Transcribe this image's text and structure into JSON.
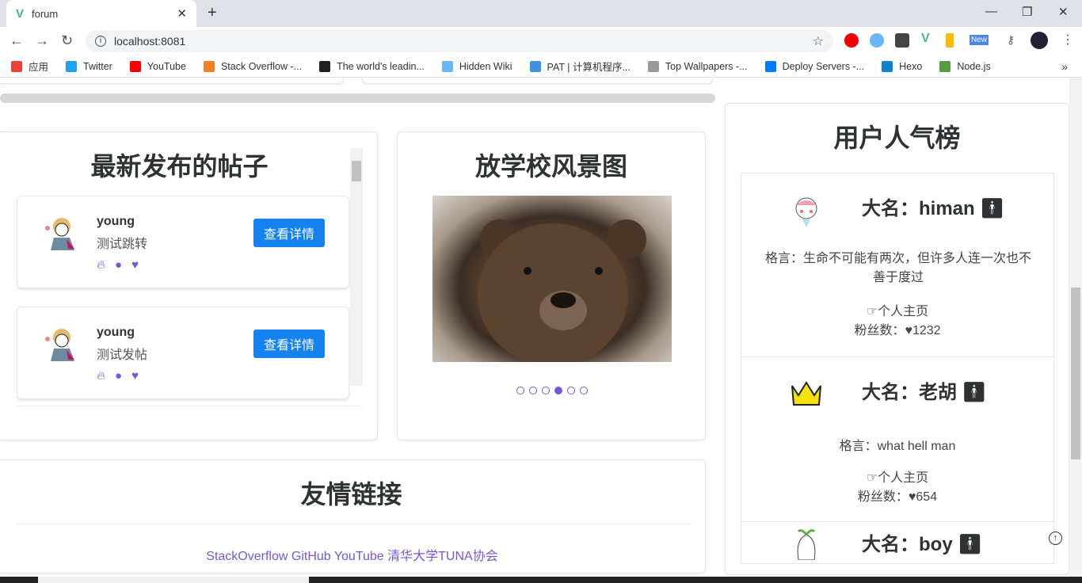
{
  "browser": {
    "tab_title": "forum",
    "url": "localhost:8081",
    "bookmarks": [
      {
        "label": "应用",
        "color": "#e94235"
      },
      {
        "label": "Twitter",
        "color": "#1da1f2"
      },
      {
        "label": "YouTube",
        "color": "#ff0000"
      },
      {
        "label": "Stack Overflow -...",
        "color": "#f48024"
      },
      {
        "label": "The world's leadin...",
        "color": "#222222"
      },
      {
        "label": "Hidden Wiki",
        "color": "#6ab7f5"
      },
      {
        "label": "PAT | 计算机程序...",
        "color": "#3d8fe0"
      },
      {
        "label": "Top Wallpapers -...",
        "color": "#999999"
      },
      {
        "label": "Deploy Servers -...",
        "color": "#007bfc"
      },
      {
        "label": "Hexo",
        "color": "#0e83cd"
      },
      {
        "label": "Node.js",
        "color": "#539e43"
      }
    ],
    "ext_badge": "New"
  },
  "latest": {
    "title": "最新发布的帖子",
    "posts": [
      {
        "user": "young",
        "title": "测试跳转",
        "button": "查看详情"
      },
      {
        "user": "young",
        "title": "测试发帖",
        "button": "查看详情"
      }
    ]
  },
  "scenery": {
    "title": "放学校风景图",
    "dots": 6,
    "active_dot": 4
  },
  "links": {
    "title": "友情链接",
    "items": [
      "StackOverflow",
      "GitHub",
      "YouTube",
      "清华大学TUNA协会"
    ]
  },
  "ranking": {
    "title": "用户人气榜",
    "users": [
      {
        "name": "大名：himan",
        "motto": "格言：生命不可能有两次，但许多人连一次也不善于度过",
        "home": "个人主页",
        "fans_label": "粉丝数：",
        "fans": "1232"
      },
      {
        "name": "大名：老胡",
        "motto": "格言：what hell man",
        "home": "个人主页",
        "fans_label": "粉丝数：",
        "fans": "654"
      },
      {
        "name": "大名：boy"
      }
    ]
  },
  "colors": {
    "accent": "#7b55d6",
    "button": "#1582f0"
  }
}
